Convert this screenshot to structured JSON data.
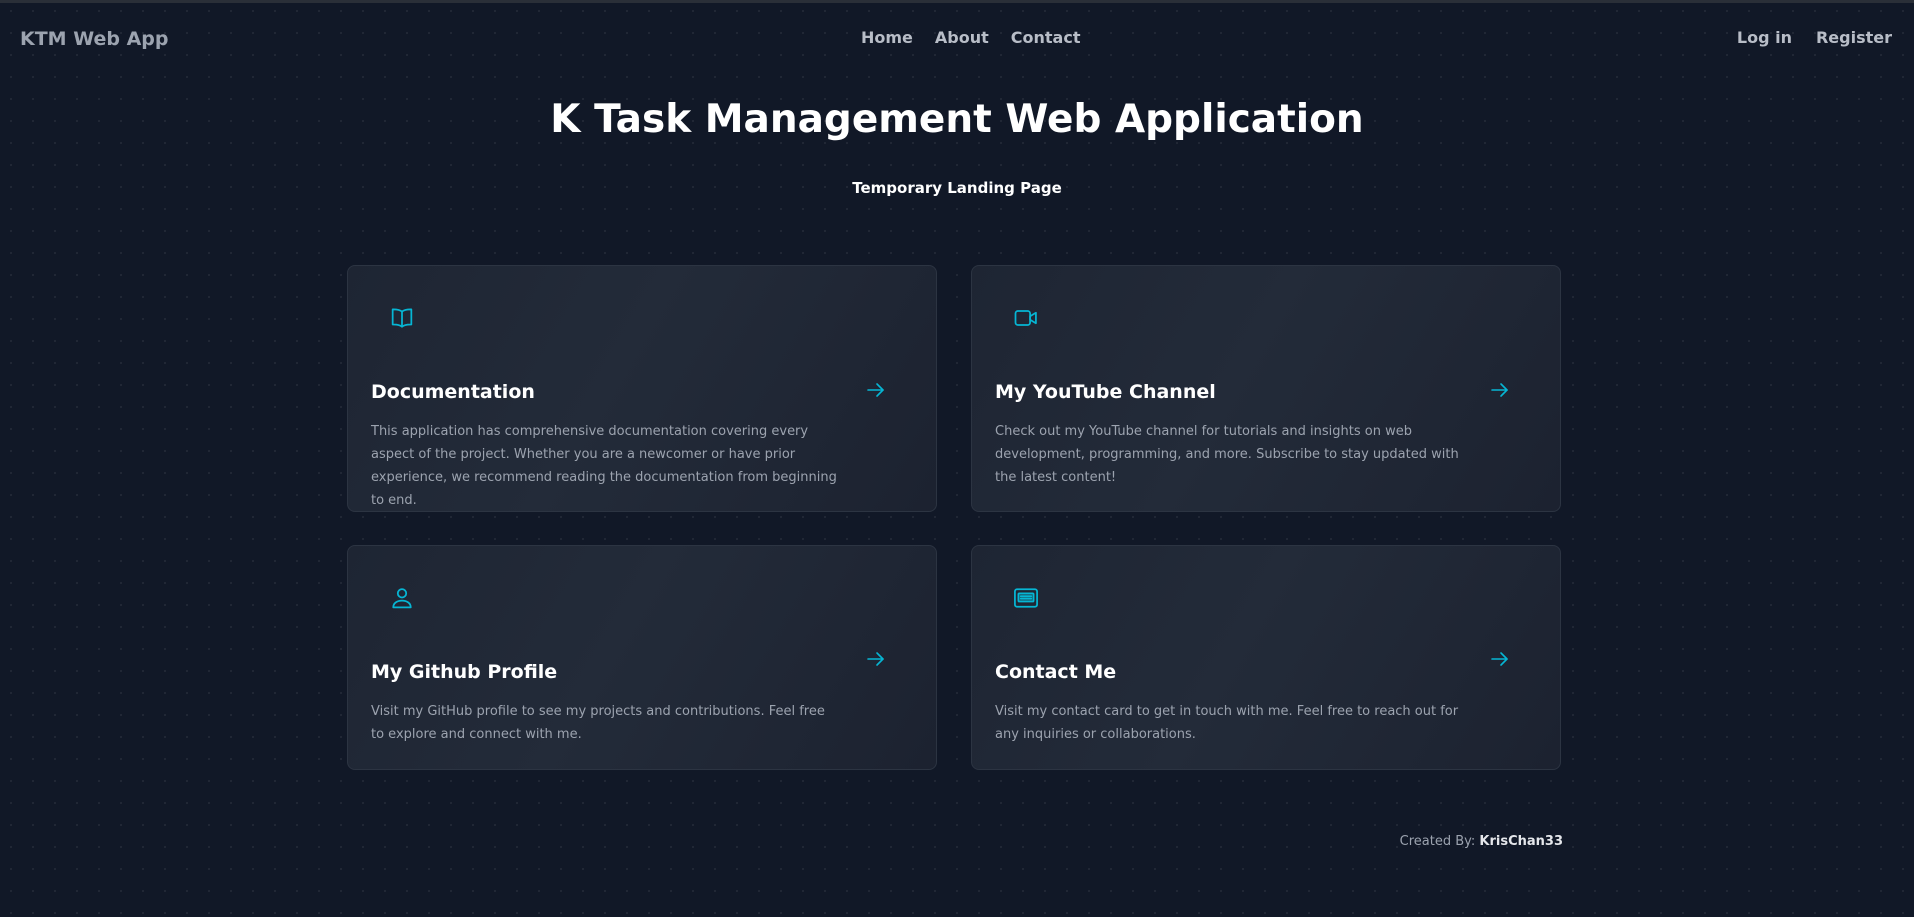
{
  "header": {
    "brand": "KTM Web App",
    "nav_center": [
      "Home",
      "About",
      "Contact"
    ],
    "nav_right": [
      "Log in",
      "Register"
    ]
  },
  "hero": {
    "title": "K Task Management Web Application",
    "subtitle": "Temporary Landing Page"
  },
  "cards": [
    {
      "icon": "book-icon",
      "title": "Documentation",
      "description": "This application has comprehensive documentation covering every aspect of the project. Whether you are a newcomer or have prior experience, we recommend reading the documentation from beginning to end."
    },
    {
      "icon": "video-camera-icon",
      "title": "My YouTube Channel",
      "description": "Check out my YouTube channel for tutorials and insights on web development, programming, and more. Subscribe to stay updated with the latest content!"
    },
    {
      "icon": "user-icon",
      "title": "My Github Profile",
      "description": "Visit my GitHub profile to see my projects and contributions. Feel free to explore and connect with me."
    },
    {
      "icon": "contact-card-icon",
      "title": "Contact Me",
      "description": "Visit my contact card to get in touch with me. Feel free to reach out for any inquiries or collaborations."
    }
  ],
  "footer": {
    "prefix": "Created By:",
    "author": "KrisChan33"
  },
  "colors": {
    "background": "#111827",
    "card": "#1f2937",
    "accent": "#06b6d4"
  }
}
